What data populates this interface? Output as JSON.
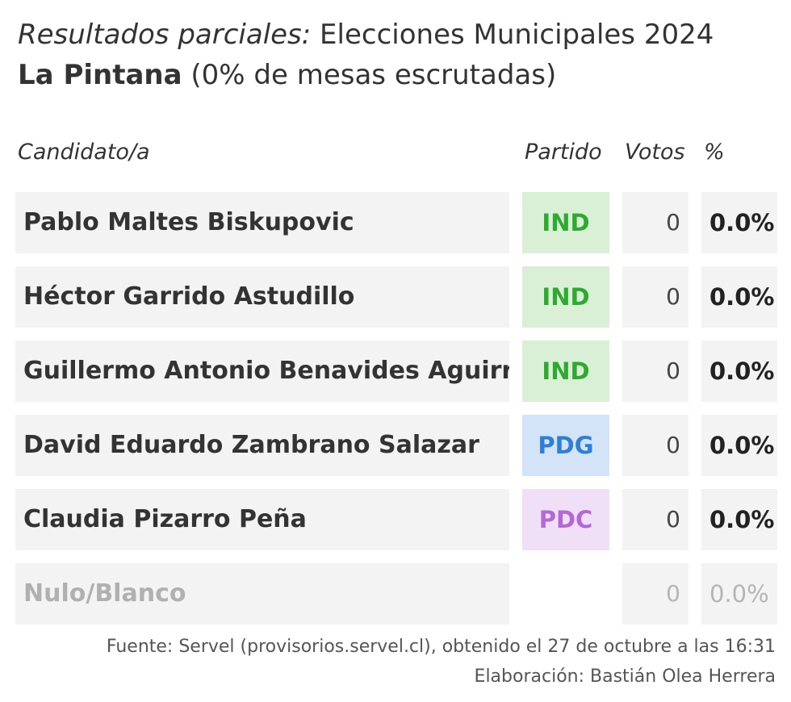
{
  "title": {
    "label_italic": "Resultados parciales:",
    "label_rest": " Elecciones Municipales 2024",
    "commune": "La Pintana",
    "progress": " (0% de mesas escrutadas)"
  },
  "headers": {
    "candidate": "Candidato/a",
    "party": "Partido",
    "votes": "Votos",
    "percent": "%"
  },
  "rows": [
    {
      "name": "Pablo Maltes Biskupovic",
      "party": "IND",
      "party_color": "#2eaa2e",
      "party_bg": "#d9f0d6",
      "votes": "0",
      "pct": "0.0%"
    },
    {
      "name": "Héctor Garrido Astudillo",
      "party": "IND",
      "party_color": "#2eaa2e",
      "party_bg": "#d9f0d6",
      "votes": "0",
      "pct": "0.0%"
    },
    {
      "name": "Guillermo Antonio Benavides Aguirre",
      "party": "IND",
      "party_color": "#2eaa2e",
      "party_bg": "#d9f0d6",
      "votes": "0",
      "pct": "0.0%"
    },
    {
      "name": "David Eduardo Zambrano Salazar",
      "party": "PDG",
      "party_color": "#2f7ed8",
      "party_bg": "#d3e4f8",
      "votes": "0",
      "pct": "0.0%"
    },
    {
      "name": "Claudia Pizarro Peña",
      "party": "PDC",
      "party_color": "#b567d6",
      "party_bg": "#efe0f7",
      "votes": "0",
      "pct": "0.0%"
    },
    {
      "name": "Nulo/Blanco",
      "party": "",
      "party_color": "",
      "party_bg": "",
      "votes": "0",
      "pct": "0.0%"
    }
  ],
  "footer": {
    "source": "Fuente: Servel (provisorios.servel.cl), obtenido el 27 de octubre a las 16:31",
    "author": "Elaboración: Bastián Olea Herrera"
  }
}
